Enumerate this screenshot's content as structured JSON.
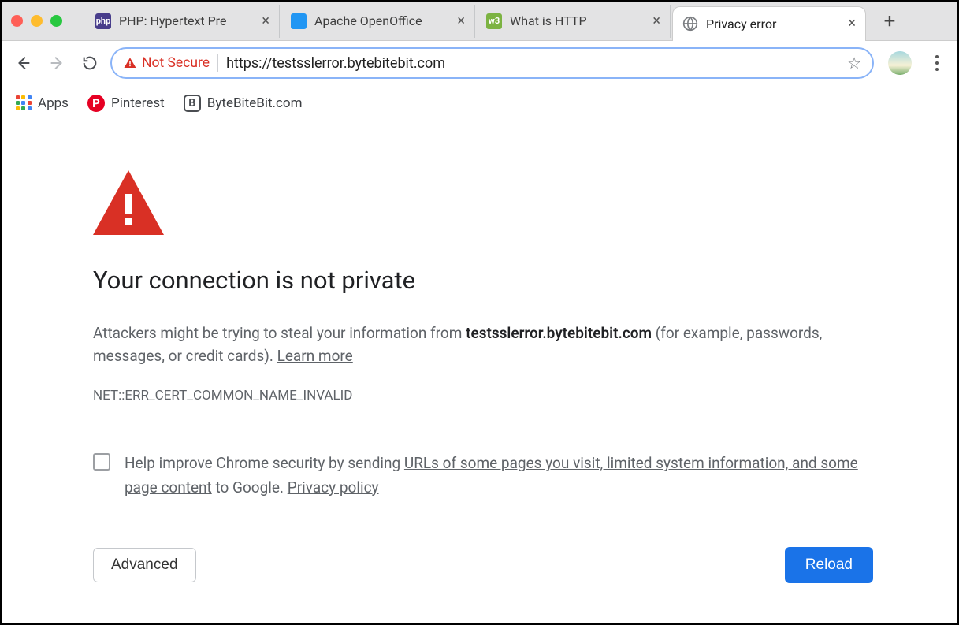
{
  "tabs": [
    {
      "label": "PHP: Hypertext Pre"
    },
    {
      "label": "Apache OpenOffice"
    },
    {
      "label": "What is HTTP"
    },
    {
      "label": "Privacy error"
    }
  ],
  "omnibox": {
    "security_label": "Not Secure",
    "url": "https://testsslerror.bytebitebit.com"
  },
  "bookmarks": {
    "apps": "Apps",
    "pinterest": "Pinterest",
    "bytebitebit": "ByteBiteBit.com"
  },
  "error": {
    "title": "Your connection is not private",
    "body_pre": "Attackers might be trying to steal your information from ",
    "body_domain": "testsslerror.bytebitebit.com",
    "body_post": " (for example, passwords, messages, or credit cards). ",
    "learn_more": "Learn more",
    "code": "NET::ERR_CERT_COMMON_NAME_INVALID",
    "optin_pre": "Help improve Chrome security by sending ",
    "optin_link1": "URLs of some pages you visit, limited system information, and some page content",
    "optin_mid": " to Google. ",
    "optin_link2": "Privacy policy",
    "advanced_btn": "Advanced",
    "reload_btn": "Reload"
  }
}
